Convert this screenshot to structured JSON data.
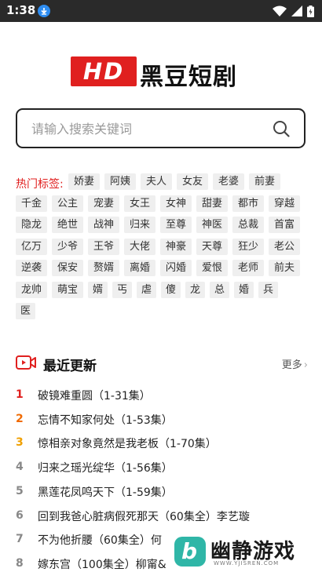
{
  "statusbar": {
    "time": "1:38"
  },
  "logo": {
    "badge": "HD",
    "name": "黑豆短剧"
  },
  "search": {
    "placeholder": "请输入搜索关键词"
  },
  "tags": {
    "label": "热门标签:",
    "items": [
      "娇妻",
      "阿姨",
      "夫人",
      "女友",
      "老婆",
      "前妻",
      "千金",
      "公主",
      "宠妻",
      "女王",
      "女神",
      "甜妻",
      "都市",
      "穿越",
      "隐龙",
      "绝世",
      "战神",
      "归来",
      "至尊",
      "神医",
      "总裁",
      "首富",
      "亿万",
      "少爷",
      "王爷",
      "大佬",
      "神豪",
      "天尊",
      "狂少",
      "老公",
      "逆袭",
      "保安",
      "赘婿",
      "离婚",
      "闪婚",
      "爱恨",
      "老师",
      "前夫",
      "龙帅",
      "萌宝",
      "婿",
      "丐",
      "虐",
      "傻",
      "龙",
      "总",
      "婚",
      "兵",
      "医"
    ]
  },
  "recent": {
    "title": "最近更新",
    "more": "更多",
    "items": [
      {
        "rank": "1",
        "title": "破镜难重圆（1-31集）"
      },
      {
        "rank": "2",
        "title": "忘情不知家何处（1-53集）"
      },
      {
        "rank": "3",
        "title": "惊相亲对象竟然是我老板（1-70集）"
      },
      {
        "rank": "4",
        "title": "归来之瑶光绽华（1-56集）"
      },
      {
        "rank": "5",
        "title": "黑莲花凤鸣天下（1-59集）"
      },
      {
        "rank": "6",
        "title": "回到我爸心脏病假死那天（60集全）李艺璇"
      },
      {
        "rank": "7",
        "title": "不为他折腰（60集全）何"
      },
      {
        "rank": "8",
        "title": "嫁东宫（100集全）柳甯&"
      }
    ]
  },
  "watermark": {
    "name": "幽静游戏",
    "url": "WWW.YJISREN.COM"
  }
}
